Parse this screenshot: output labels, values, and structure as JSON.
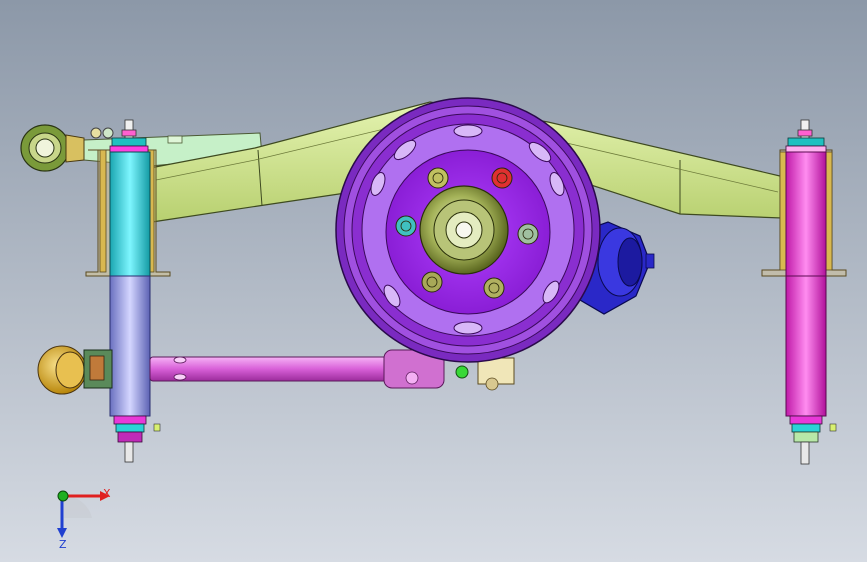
{
  "viewport": {
    "background_top": "#8c98a8",
    "background_bottom": "#d6dbe3"
  },
  "triad": {
    "x_label": "X",
    "z_label": "Z",
    "x_color": "#e02020",
    "y_color": "#20b020",
    "z_color": "#2040d0"
  },
  "model": {
    "frame_arm_color": "#cfe48a",
    "left_shock_upper_color": "#32e0e8",
    "left_shock_lower_color": "#9aa0e6",
    "right_shock_color": "#ff34d8",
    "tie_rod_color": "#e87ae8",
    "wheel_rim_color": "#8d2ecf",
    "hub_color": "#9a20e6",
    "center_hub_color": "#7a8a2a",
    "brake_caliper_color": "#2a28c8",
    "bushing_color": "#d8a830",
    "bracket_color": "#e8c870"
  }
}
